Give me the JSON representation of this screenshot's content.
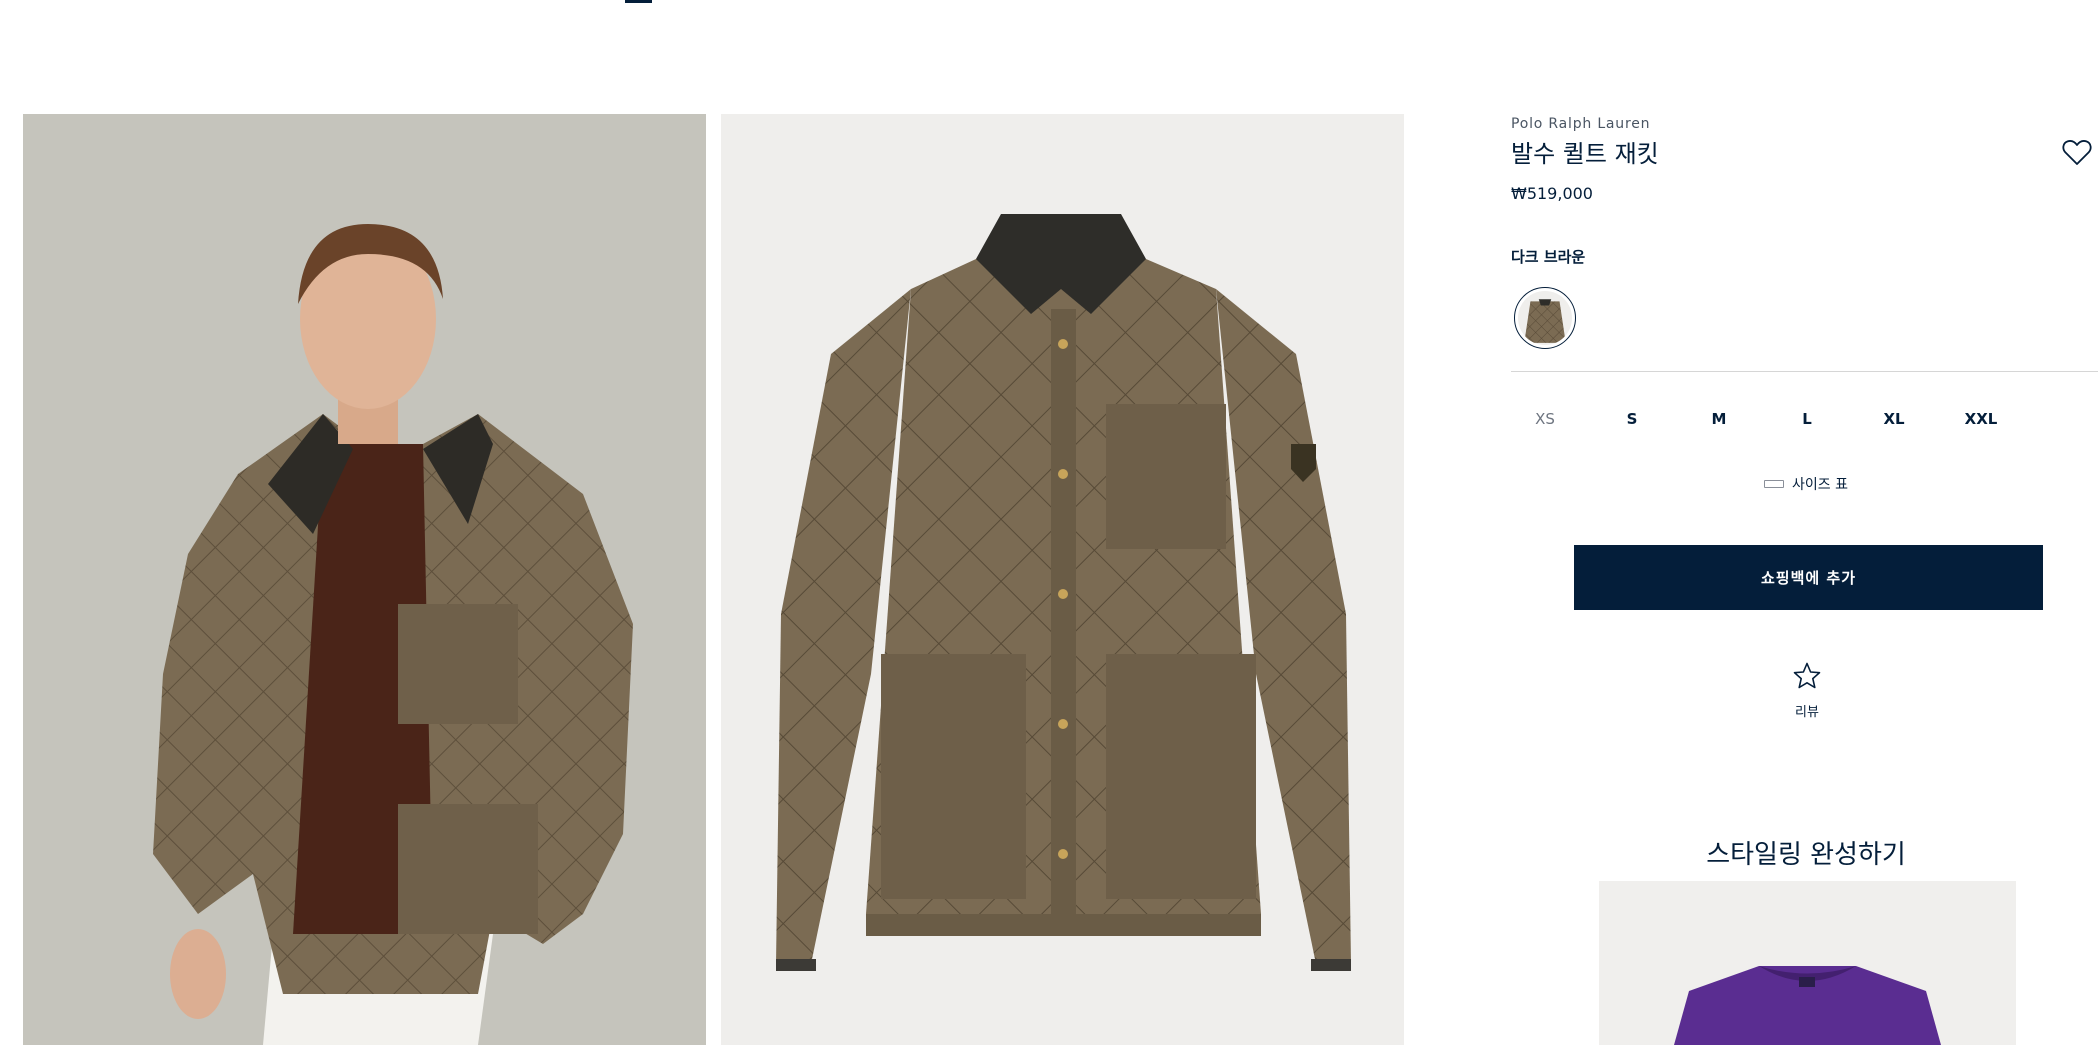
{
  "product": {
    "brand": "Polo Ralph Lauren",
    "title": "발수 퀼트 재킷",
    "price": "₩519,000",
    "color_name": "다크 브라운"
  },
  "sizes": [
    {
      "label": "XS",
      "available": false
    },
    {
      "label": "S",
      "available": true
    },
    {
      "label": "M",
      "available": true
    },
    {
      "label": "L",
      "available": true
    },
    {
      "label": "XL",
      "available": true
    },
    {
      "label": "XXL",
      "available": true
    }
  ],
  "size_chart_label": "사이즈 표",
  "add_to_bag_label": "쇼핑백에 추가",
  "reviews_label": "리뷰",
  "complete_look_title": "스타일링 완성하기",
  "icons": {
    "wishlist": "heart-icon",
    "reviews": "star-icon",
    "size_chart": "ruler-icon"
  },
  "colors": {
    "navy": "#041e3a",
    "jacket": "#7a6a52",
    "sweater": "#5a2d91"
  }
}
